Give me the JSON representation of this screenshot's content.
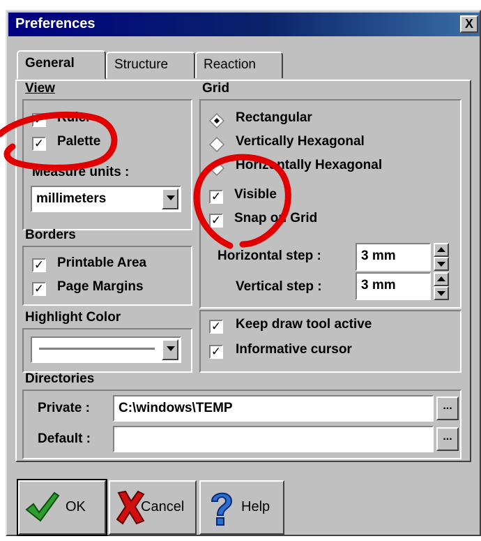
{
  "window": {
    "title": "Preferences",
    "close_glyph": "X"
  },
  "tabs": [
    {
      "label": "General",
      "active": true
    },
    {
      "label": "Structure",
      "active": false
    },
    {
      "label": "Reaction",
      "active": false
    }
  ],
  "view": {
    "heading": "View",
    "ruler_label": "Ruler",
    "ruler_checked": true,
    "palette_label": "Palette",
    "palette_checked": true,
    "measure_units_label": "Measure units :",
    "measure_units_value": "millimeters"
  },
  "borders": {
    "heading": "Borders",
    "printable_area_label": "Printable Area",
    "printable_area_checked": true,
    "page_margins_label": "Page Margins",
    "page_margins_checked": true
  },
  "highlight": {
    "heading": "Highlight Color"
  },
  "grid": {
    "heading": "Grid",
    "options": [
      "Rectangular",
      "Vertically Hexagonal",
      "Horizontally Hexagonal"
    ],
    "selected": "Rectangular",
    "visible_label": "Visible",
    "visible_checked": true,
    "snap_label": "Snap on Grid",
    "snap_checked": true,
    "horizontal_step_label": "Horizontal step :",
    "horizontal_step_value": "3 mm",
    "vertical_step_label": "Vertical step :",
    "vertical_step_value": "3 mm"
  },
  "tools": {
    "keep_active_label": "Keep draw tool active",
    "keep_active_checked": true,
    "informative_cursor_label": "Informative cursor",
    "informative_cursor_checked": true
  },
  "directories": {
    "heading": "Directories",
    "private_label": "Private :",
    "private_value": "C:\\windows\\TEMP",
    "default_label": "Default :",
    "default_value": "",
    "browse_glyph": "..."
  },
  "buttons": {
    "ok": "OK",
    "cancel": "Cancel",
    "help": "Help"
  },
  "colors": {
    "title_bar": "#000080",
    "face": "#c0c0c0",
    "annotation": "#e00000"
  },
  "check_glyph": "✓"
}
